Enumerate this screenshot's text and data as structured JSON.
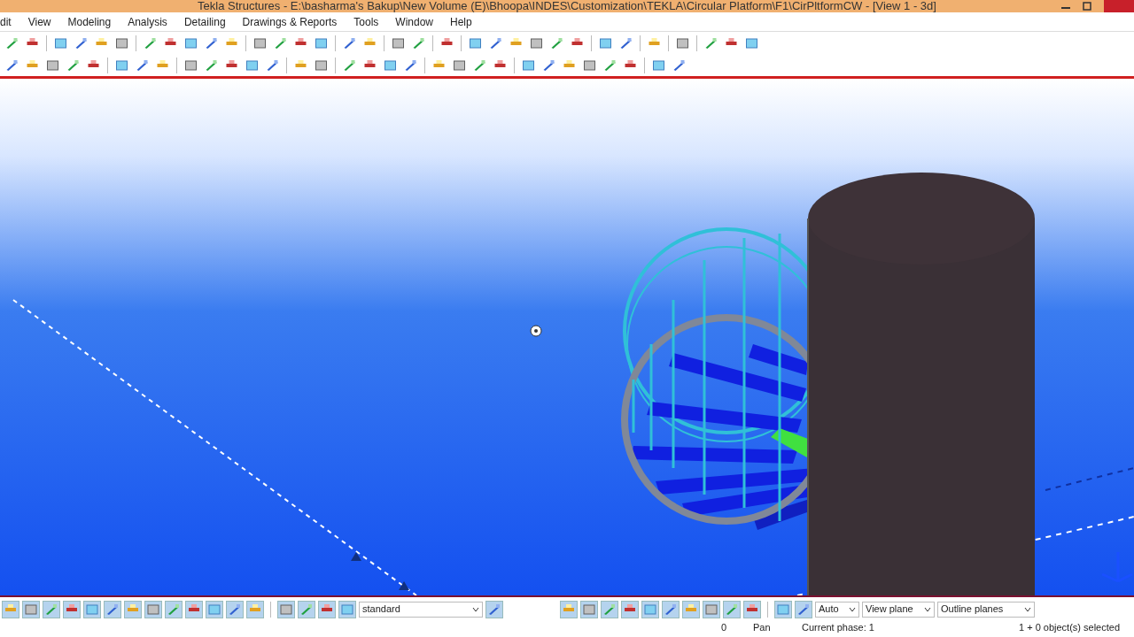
{
  "window": {
    "title": "Tekla Structures - E:\\basharma's Bakup\\New Volume (E)\\Bhoopa\\INDES\\Customization\\TEKLA\\Circular Platform\\F1\\CirPltformCW - [View 1 - 3d]"
  },
  "menu": [
    "dit",
    "View",
    "Modeling",
    "Analysis",
    "Detailing",
    "Drawings & Reports",
    "Tools",
    "Window",
    "Help"
  ],
  "bottom_toolbar": {
    "filter": "standard",
    "dropdowns": [
      "Auto",
      "View plane",
      "Outline planes"
    ]
  },
  "status_bar": [
    "0",
    "Pan",
    "Current phase: 1",
    "1 + 0 object(s) selected"
  ]
}
